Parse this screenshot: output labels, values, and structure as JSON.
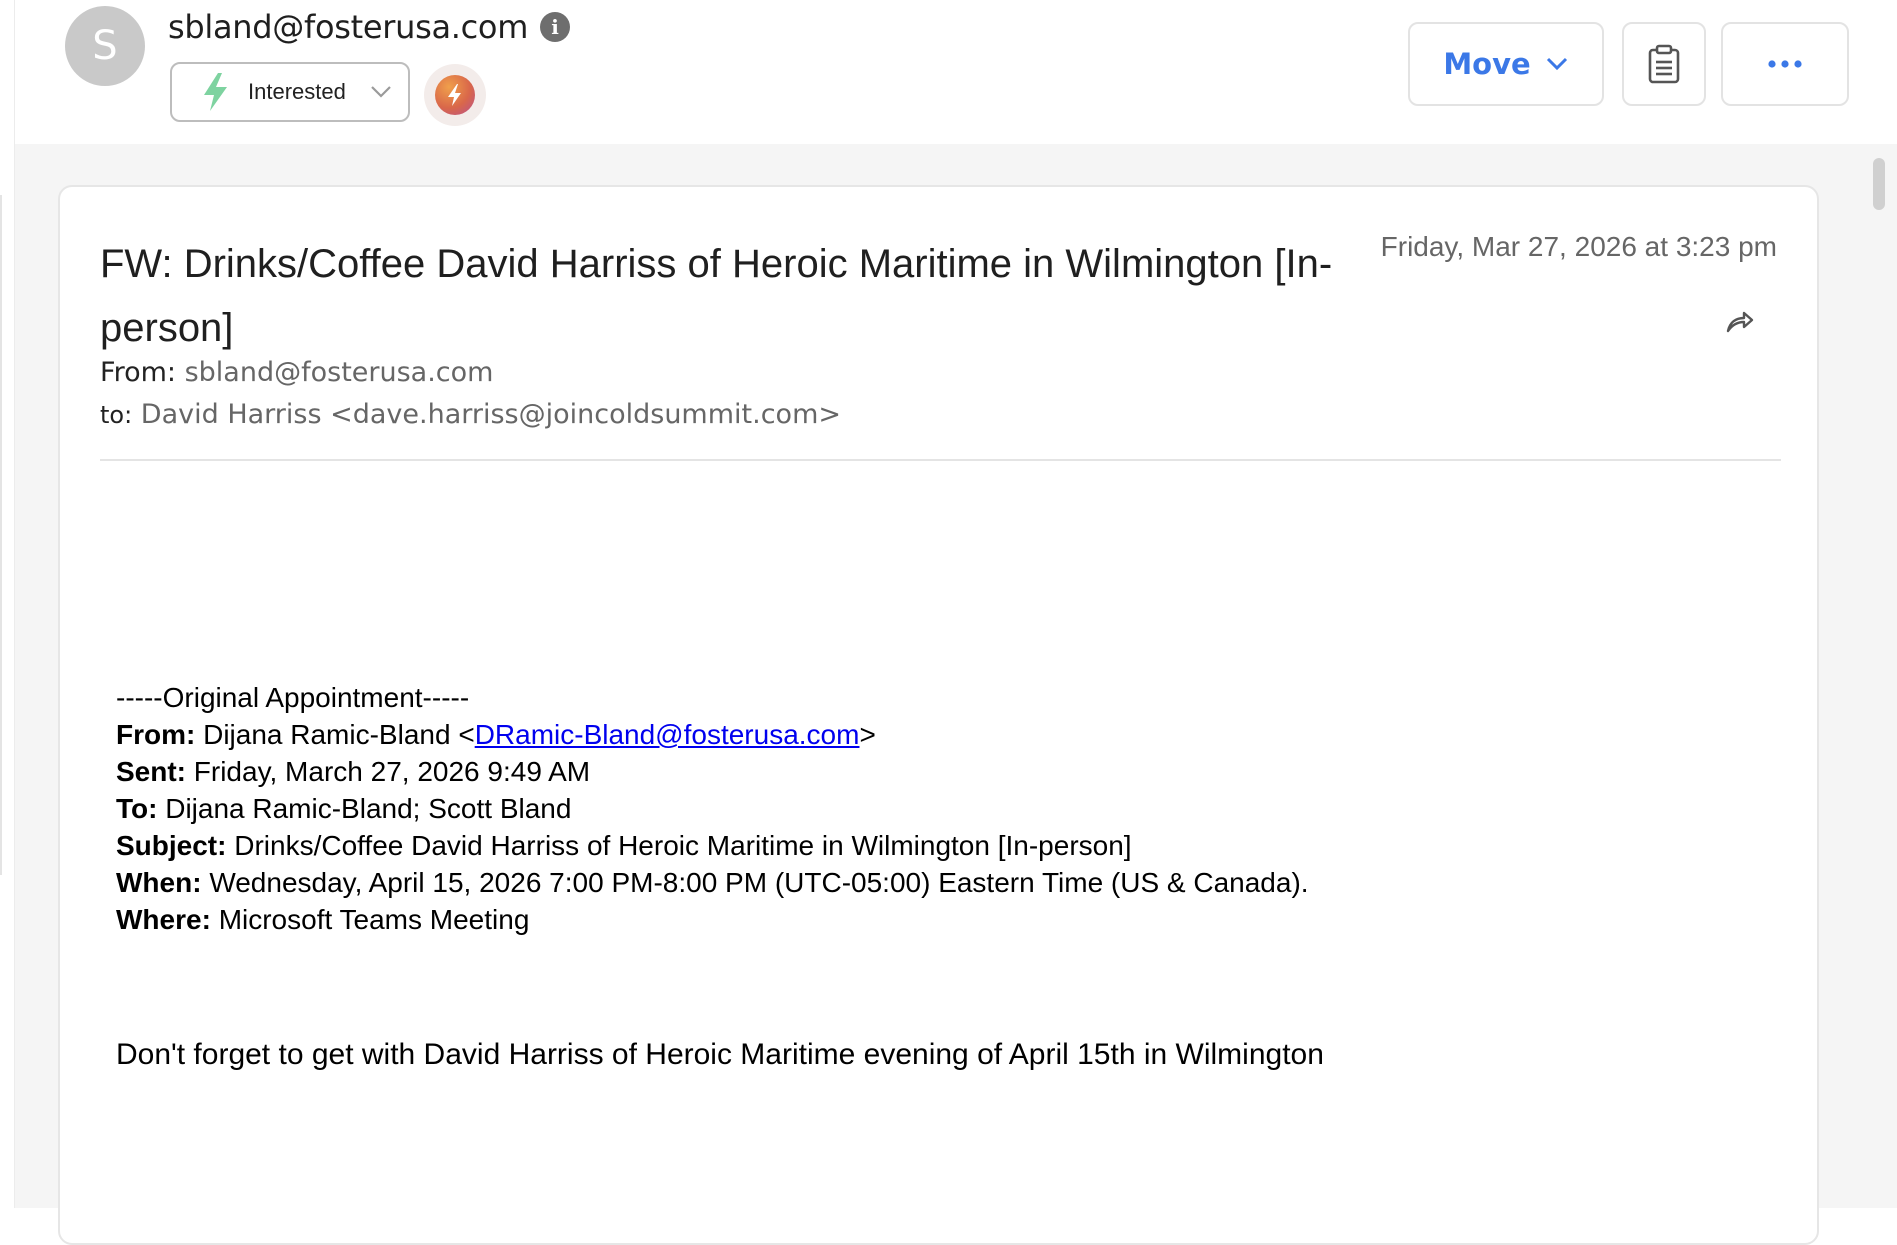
{
  "header": {
    "avatar_letter": "S",
    "sender_email": "sbland@fosterusa.com",
    "info_icon": "info-icon",
    "status": {
      "label": "Interested",
      "icon": "lightning-bolt-icon",
      "icon_color": "#7ed3a0"
    },
    "ai_button_icon": "ai-bolt-icon",
    "move_label": "Move",
    "move_color": "#3b78e7",
    "note_icon": "clipboard-icon",
    "more_icon": "more-dots-icon"
  },
  "email": {
    "subject": "FW: Drinks/Coffee David Harriss of Heroic Maritime in Wilmington [In-person]",
    "date": "Friday, Mar 27, 2026 at 3:23 pm",
    "from_label": "From:",
    "from_value": "sbland@fosterusa.com",
    "to_label": "to:",
    "to_value": "David Harriss <dave.harriss@joincoldsummit.com>",
    "body": {
      "original_header": "-----Original Appointment-----",
      "from_label": "From:",
      "from_name": "Dijana Ramic-Bland <",
      "from_link": "DRamic-Bland@fosterusa.com",
      "from_close": ">",
      "sent_label": "Sent:",
      "sent_value": "Friday, March 27, 2026 9:49 AM",
      "to_label": "To:",
      "to_value": "Dijana Ramic-Bland; Scott Bland",
      "subject_label": "Subject:",
      "subject_value": "Drinks/Coffee David Harriss of Heroic Maritime in Wilmington [In-person]",
      "when_label": "When:",
      "when_value": "Wednesday, April 15, 2026 7:00 PM-8:00 PM (UTC-05:00) Eastern Time (US & Canada).",
      "where_label": "Where:",
      "where_value": "Microsoft Teams Meeting",
      "note": "Don't forget to get with David Harriss of Heroic Maritime evening of April 15th in Wilmington"
    }
  }
}
